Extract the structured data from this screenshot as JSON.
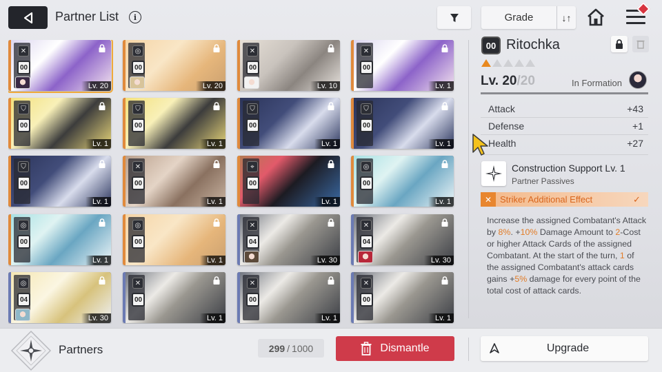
{
  "header": {
    "title": "Partner List",
    "info_glyph": "i",
    "grade_label": "Grade",
    "sort_glyph": "↓↑"
  },
  "cards": [
    {
      "cost": "00",
      "level": "Lv. 20",
      "class": "striker",
      "locked": true,
      "selected": true,
      "edge": "#e08a3c",
      "art": "linear-gradient(135deg,#d9d2ee 0%,#ffffff 35%,#8c63c9 60%,#f4e4ee 100%)",
      "mini": "#3a2a44"
    },
    {
      "cost": "00",
      "level": "Lv. 20",
      "class": "controller",
      "locked": true,
      "selected": false,
      "edge": "#e08a3c",
      "art": "linear-gradient(135deg,#f5d4a5 0%,#f9e6c6 40%,#e6b67b 70%,#caa070 100%)",
      "mini": "#d8c49a"
    },
    {
      "cost": "00",
      "level": "Lv. 10",
      "class": "striker",
      "locked": true,
      "selected": false,
      "edge": "#e08a3c",
      "art": "linear-gradient(135deg,#e9e2d9 0%,#c9c3bd 40%,#8b8580 65%,#e9e4df 100%)",
      "mini": "#f2f2f2"
    },
    {
      "cost": "00",
      "level": "Lv. 1",
      "class": "striker",
      "locked": true,
      "selected": false,
      "edge": "#e08a3c",
      "art": "linear-gradient(135deg,#d9d2ee 0%,#ffffff 35%,#8c63c9 60%,#f4e4ee 100%)",
      "mini": ""
    },
    {
      "cost": "00",
      "level": "Lv. 1",
      "class": "vanguard",
      "locked": true,
      "selected": false,
      "edge": "#e08a3c",
      "art": "linear-gradient(135deg,#f3e07a 0%,#f8f0b8 35%,#3c3c3c 60%,#e9d77a 100%)",
      "mini": ""
    },
    {
      "cost": "00",
      "level": "Lv. 1",
      "class": "vanguard",
      "locked": true,
      "selected": false,
      "edge": "#e08a3c",
      "art": "linear-gradient(135deg,#f3e07a 0%,#f8f0b8 35%,#3c3c3c 60%,#e9d77a 100%)",
      "mini": ""
    },
    {
      "cost": "00",
      "level": "Lv. 1",
      "class": "vanguard",
      "locked": true,
      "selected": false,
      "edge": "#e08a3c",
      "art": "linear-gradient(135deg,#2a3358 0%,#424d7a 40%,#d8dcec 65%,#2b355d 100%)",
      "mini": ""
    },
    {
      "cost": "00",
      "level": "Lv. 1",
      "class": "vanguard",
      "locked": true,
      "selected": false,
      "edge": "#e08a3c",
      "art": "linear-gradient(135deg,#2a3358 0%,#424d7a 40%,#d8dcec 65%,#2b355d 100%)",
      "mini": ""
    },
    {
      "cost": "00",
      "level": "Lv. 1",
      "class": "vanguard",
      "locked": true,
      "selected": false,
      "edge": "#e08a3c",
      "art": "linear-gradient(135deg,#2a3358 0%,#424d7a 40%,#d8dcec 65%,#2b355d 100%)",
      "mini": ""
    },
    {
      "cost": "00",
      "level": "Lv. 1",
      "class": "striker",
      "locked": true,
      "selected": false,
      "edge": "#e08a3c",
      "art": "linear-gradient(135deg,#b89e8a 0%,#e4d4c6 40%,#8a7160 65%,#c9b4a2 100%)",
      "mini": ""
    },
    {
      "cost": "00",
      "level": "Lv. 1",
      "class": "ranger",
      "locked": true,
      "selected": false,
      "edge": "#e08a3c",
      "art": "linear-gradient(135deg,#b07b52 0%,#e25a6a 30%,#1c1b22 55%,#3a6aa5 100%)",
      "mini": ""
    },
    {
      "cost": "00",
      "level": "Lv. 1",
      "class": "controller",
      "locked": true,
      "selected": false,
      "edge": "#e08a3c",
      "art": "linear-gradient(135deg,#a4e0e3 0%,#dff3f2 35%,#6aa6c2 60%,#eef6f8 100%)",
      "mini": ""
    },
    {
      "cost": "00",
      "level": "Lv. 1",
      "class": "controller",
      "locked": true,
      "selected": false,
      "edge": "#e08a3c",
      "art": "linear-gradient(135deg,#a4e0e3 0%,#dff3f2 35%,#6aa6c2 60%,#eef6f8 100%)",
      "mini": ""
    },
    {
      "cost": "00",
      "level": "Lv. 1",
      "class": "controller",
      "locked": true,
      "selected": false,
      "edge": "#e08a3c",
      "art": "linear-gradient(135deg,#f5d4a5 0%,#f9e6c6 40%,#e6b67b 70%,#caa070 100%)",
      "mini": ""
    },
    {
      "cost": "04",
      "level": "Lv. 30",
      "class": "striker",
      "locked": true,
      "selected": false,
      "edge": "#6b7ab3",
      "art": "linear-gradient(135deg,#6a6f7a 0%,#eceae6 35%,#9a9790 55%,#3a3d44 100%)",
      "mini": "#5c4a3a"
    },
    {
      "cost": "04",
      "level": "Lv. 30",
      "class": "striker",
      "locked": true,
      "selected": false,
      "edge": "#6b7ab3",
      "art": "linear-gradient(135deg,#6a6f7a 0%,#eceae6 35%,#9a9790 55%,#3a3d44 100%)",
      "mini": "#b8283a"
    },
    {
      "cost": "04",
      "level": "Lv. 30",
      "class": "controller",
      "locked": true,
      "selected": false,
      "edge": "#6b7ab3",
      "art": "linear-gradient(135deg,#f4e6b0 0%,#fbf6e2 40%,#d7c27c 65%,#eef1f5 100%)",
      "mini": "#8fb8c8"
    },
    {
      "cost": "00",
      "level": "Lv. 1",
      "class": "striker",
      "locked": true,
      "selected": false,
      "edge": "#6b7ab3",
      "art": "linear-gradient(135deg,#6a6f7a 0%,#eceae6 35%,#9a9790 55%,#3a3d44 100%)",
      "mini": ""
    },
    {
      "cost": "00",
      "level": "Lv. 1",
      "class": "striker",
      "locked": true,
      "selected": false,
      "edge": "#6b7ab3",
      "art": "linear-gradient(135deg,#6a6f7a 0%,#eceae6 35%,#9a9790 55%,#3a3d44 100%)",
      "mini": ""
    },
    {
      "cost": "00",
      "level": "Lv. 1",
      "class": "striker",
      "locked": true,
      "selected": false,
      "edge": "#6b7ab3",
      "art": "linear-gradient(135deg,#6a6f7a 0%,#eceae6 35%,#9a9790 55%,#3a3d44 100%)",
      "mini": ""
    }
  ],
  "detail": {
    "cost": "00",
    "name": "Ritochka",
    "stars_filled": 1,
    "stars_total": 5,
    "level_current": "Lv. 20",
    "level_sep": "/",
    "level_max": "20",
    "xp_fraction": 1.0,
    "in_formation": "In Formation",
    "stats": [
      {
        "label": "Attack",
        "value": "+43"
      },
      {
        "label": "Defense",
        "value": "+1"
      },
      {
        "label": "Health",
        "value": "+27"
      }
    ],
    "skill_title": "Construction Support Lv. 1",
    "skill_subtitle": "Partner Passives",
    "striker_label": "Striker Additional Effect",
    "striker_check": "✓",
    "description": [
      {
        "text": "Increase the assigned Combatant's Attack by "
      },
      {
        "text": "8%",
        "hl": true
      },
      {
        "text": ". +"
      },
      {
        "text": "10%",
        "hl": true
      },
      {
        "text": " Damage Amount to "
      },
      {
        "text": "2",
        "hl": true
      },
      {
        "text": "-Cost or higher Attack Cards of the assigned Combatant. At the start of the turn, "
      },
      {
        "text": "1",
        "hl": true
      },
      {
        "text": " of the assigned Combatant's attack cards gains +"
      },
      {
        "text": "5%",
        "hl": true
      },
      {
        "text": " damage for every point of the total cost of attack cards."
      }
    ]
  },
  "footer": {
    "partners_label": "Partners",
    "count_current": "299",
    "count_sep": "/",
    "count_max": "1000",
    "dismantle_label": "Dismantle",
    "upgrade_label": "Upgrade"
  },
  "colors": {
    "accent_orange": "#e27b25",
    "dismantle_red": "#cf3b4a",
    "selected_outline": "#f0a93a"
  }
}
